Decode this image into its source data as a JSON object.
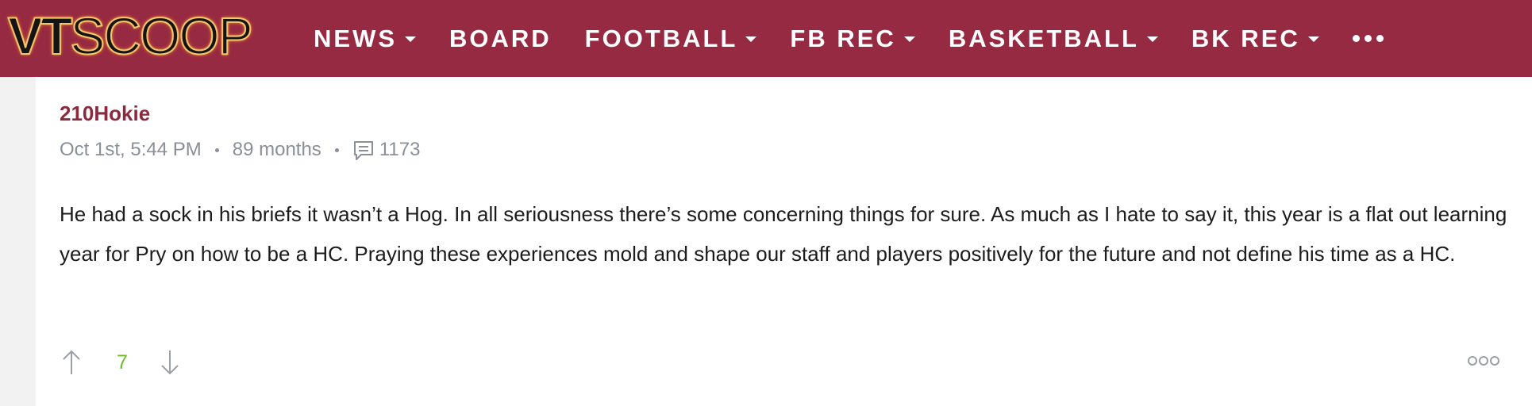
{
  "header": {
    "logo_vt": "VT",
    "logo_scoop": "SCOOP",
    "nav": [
      {
        "label": "NEWS",
        "has_dropdown": true
      },
      {
        "label": "BOARD",
        "has_dropdown": false
      },
      {
        "label": "FOOTBALL",
        "has_dropdown": true
      },
      {
        "label": "FB REC",
        "has_dropdown": true
      },
      {
        "label": "BASKETBALL",
        "has_dropdown": true
      },
      {
        "label": "BK REC",
        "has_dropdown": true
      }
    ],
    "more_icon": "ellipsis-icon"
  },
  "post": {
    "author": "210Hokie",
    "timestamp": "Oct 1st, 5:44 PM",
    "tenure": "89 months",
    "post_count": "1173",
    "body": "He had a sock in his briefs it wasn’t a Hog. In all seriousness there’s some concerning things for sure. As much as I hate to say it, this year is a flat out learning year for Pry on how to be a HC. Praying these experiences mold and shape our staff and players positively for the future and not define his time as a HC.",
    "votes": "7"
  },
  "colors": {
    "brand": "#962a42",
    "author": "#8b2a3d",
    "vote": "#6fba2c",
    "meta": "#8a8f98"
  }
}
